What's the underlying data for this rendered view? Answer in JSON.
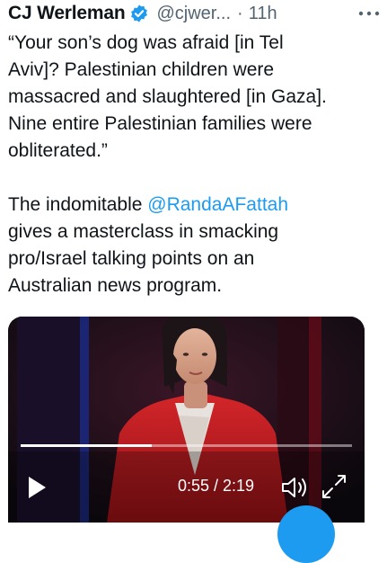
{
  "tweet": {
    "author_name": "CJ Werleman",
    "handle": "@cjwer...",
    "separator": "·",
    "time": "11h",
    "text_before_mention": "“Your son’s dog was afraid [in Tel\nAviv]? Palestinian children were\nmassacred and slaughtered [in Gaza].\nNine entire Palestinian families were\nobliterated.”\n\nThe indomitable ",
    "mention": "@RandaAFattah",
    "text_after_mention": "\ngives a masterclass in smacking\npro/Israel talking points on an\nAustralian news program."
  },
  "video": {
    "current_time": "0:55",
    "duration": "2:19",
    "time_display": "0:55 / 2:19",
    "progress_fraction": 0.3957
  },
  "icons": {
    "verified": "verified-badge-icon",
    "more": "more-options-icon",
    "play": "play-icon",
    "volume": "volume-icon",
    "fullscreen": "fullscreen-icon",
    "compose": "compose-button"
  },
  "colors": {
    "accent": "#1d9bf0",
    "text": "#0f1419",
    "secondary": "#536471"
  }
}
